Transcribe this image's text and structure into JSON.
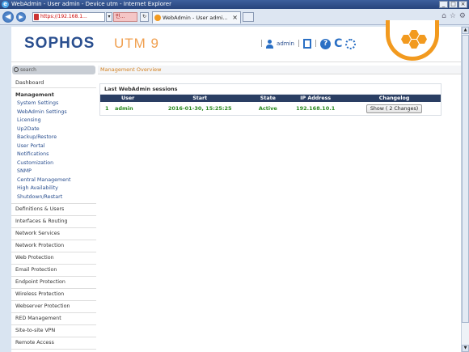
{
  "window": {
    "title": "WebAdmin - User admin - Device utm - Internet Explorer",
    "controls": [
      "_",
      "□",
      "×"
    ]
  },
  "browser": {
    "url": "https://192.168.1...",
    "error_text": "인...",
    "tab_title": "WebAdmin - User admi...",
    "tab_close": "×"
  },
  "header": {
    "logo": "SOPHOS",
    "product": "UTM 9",
    "user": "admin",
    "help": "?",
    "reload": "C"
  },
  "sidebar": {
    "search_placeholder": "search",
    "dashboard": "Dashboard",
    "active_section": "Management",
    "sub_items": [
      "System Settings",
      "WebAdmin Settings",
      "Licensing",
      "Up2Date",
      "Backup/Restore",
      "User Portal",
      "Notifications",
      "Customization",
      "SNMP",
      "Central Management",
      "High Availability",
      "Shutdown/Restart"
    ],
    "sections": [
      "Definitions & Users",
      "Interfaces & Routing",
      "Network Services",
      "Network Protection",
      "Web Protection",
      "Email Protection",
      "Endpoint Protection",
      "Wireless Protection",
      "Webserver Protection",
      "RED Management",
      "Site-to-site VPN",
      "Remote Access"
    ]
  },
  "main": {
    "breadcrumb": "Management Overview",
    "panel_title": "Last WebAdmin sessions",
    "columns": [
      "User",
      "Start",
      "State",
      "IP Address",
      "Changelog"
    ],
    "rows": [
      {
        "num": "1",
        "user": "admin",
        "start": "2016-01-30, 15:25:25",
        "state": "Active",
        "ip": "192.168.10.1",
        "changelog": "Show ( 2 Changes)"
      }
    ]
  },
  "colors": {
    "brand_blue": "#2a4f8f",
    "accent_orange": "#f29a1f",
    "active_green": "#2a8a1f",
    "table_header": "#2a3e63"
  },
  "icons": [
    "ie-icon",
    "back-icon",
    "forward-icon",
    "lock-icon",
    "search-icon",
    "user-icon",
    "document-icon",
    "help-icon",
    "reload-icon",
    "spinner-icon",
    "home-icon",
    "star-icon",
    "gear-icon"
  ]
}
